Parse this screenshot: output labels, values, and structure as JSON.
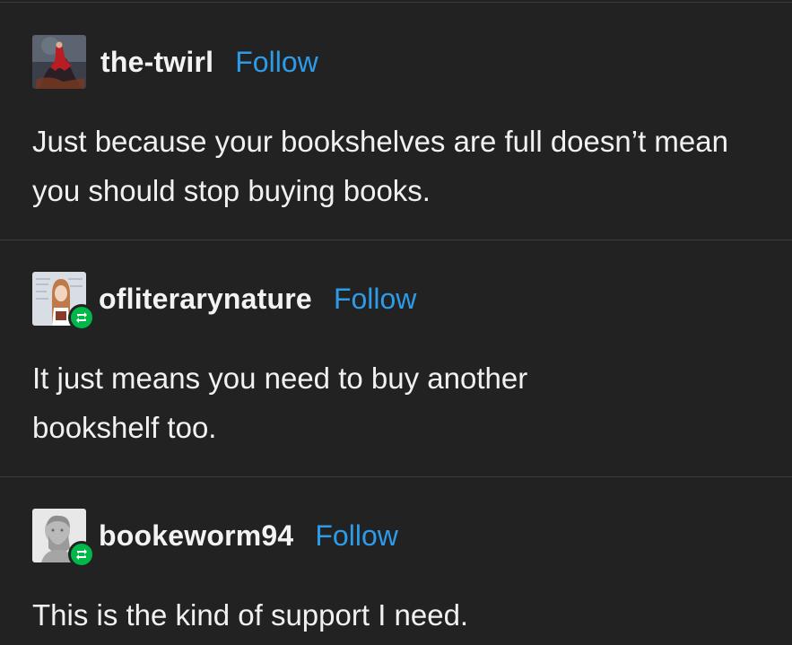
{
  "posts": [
    {
      "username": "the-twirl",
      "follow_label": "Follow",
      "text": "Just because your bookshelves are full doesn’t mean you should stop buying books.",
      "avatar_icon": "dancer-painting-avatar",
      "reblog": false
    },
    {
      "username": "ofliterarynature",
      "follow_label": "Follow",
      "text": "It just means you need to buy another bookshelf too.",
      "avatar_icon": "illustrated-reader-avatar",
      "reblog": true
    },
    {
      "username": "bookeworm94",
      "follow_label": "Follow",
      "text": "This is the kind of support I need.",
      "avatar_icon": "marble-bust-avatar",
      "reblog": true
    }
  ],
  "colors": {
    "background": "#222222",
    "follow": "#2c9be9",
    "reblog_badge": "#00b84a"
  }
}
